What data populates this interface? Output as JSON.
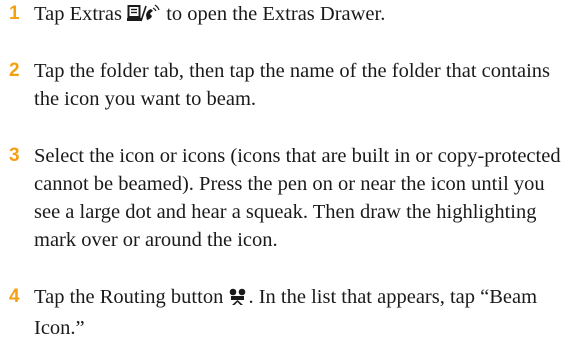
{
  "accent_color": "#f4a012",
  "steps": [
    {
      "number": "1",
      "segments": [
        "Tap Extras ",
        " to open the Extras Drawer."
      ],
      "icon": "extras-drawer-icon"
    },
    {
      "number": "2",
      "text": "Tap the folder tab, then tap the name of the folder that contains the icon you want to beam."
    },
    {
      "number": "3",
      "text": "Select the icon or icons (icons that are built in or copy-protected cannot be beamed). Press the pen on or near the icon until you see a large dot and hear a squeak. Then draw the highlighting mark over or around the icon."
    },
    {
      "number": "4",
      "segments": [
        "Tap the Routing button ",
        ". In the list that appears, tap “Beam Icon.”"
      ],
      "icon": "routing-icon"
    }
  ]
}
